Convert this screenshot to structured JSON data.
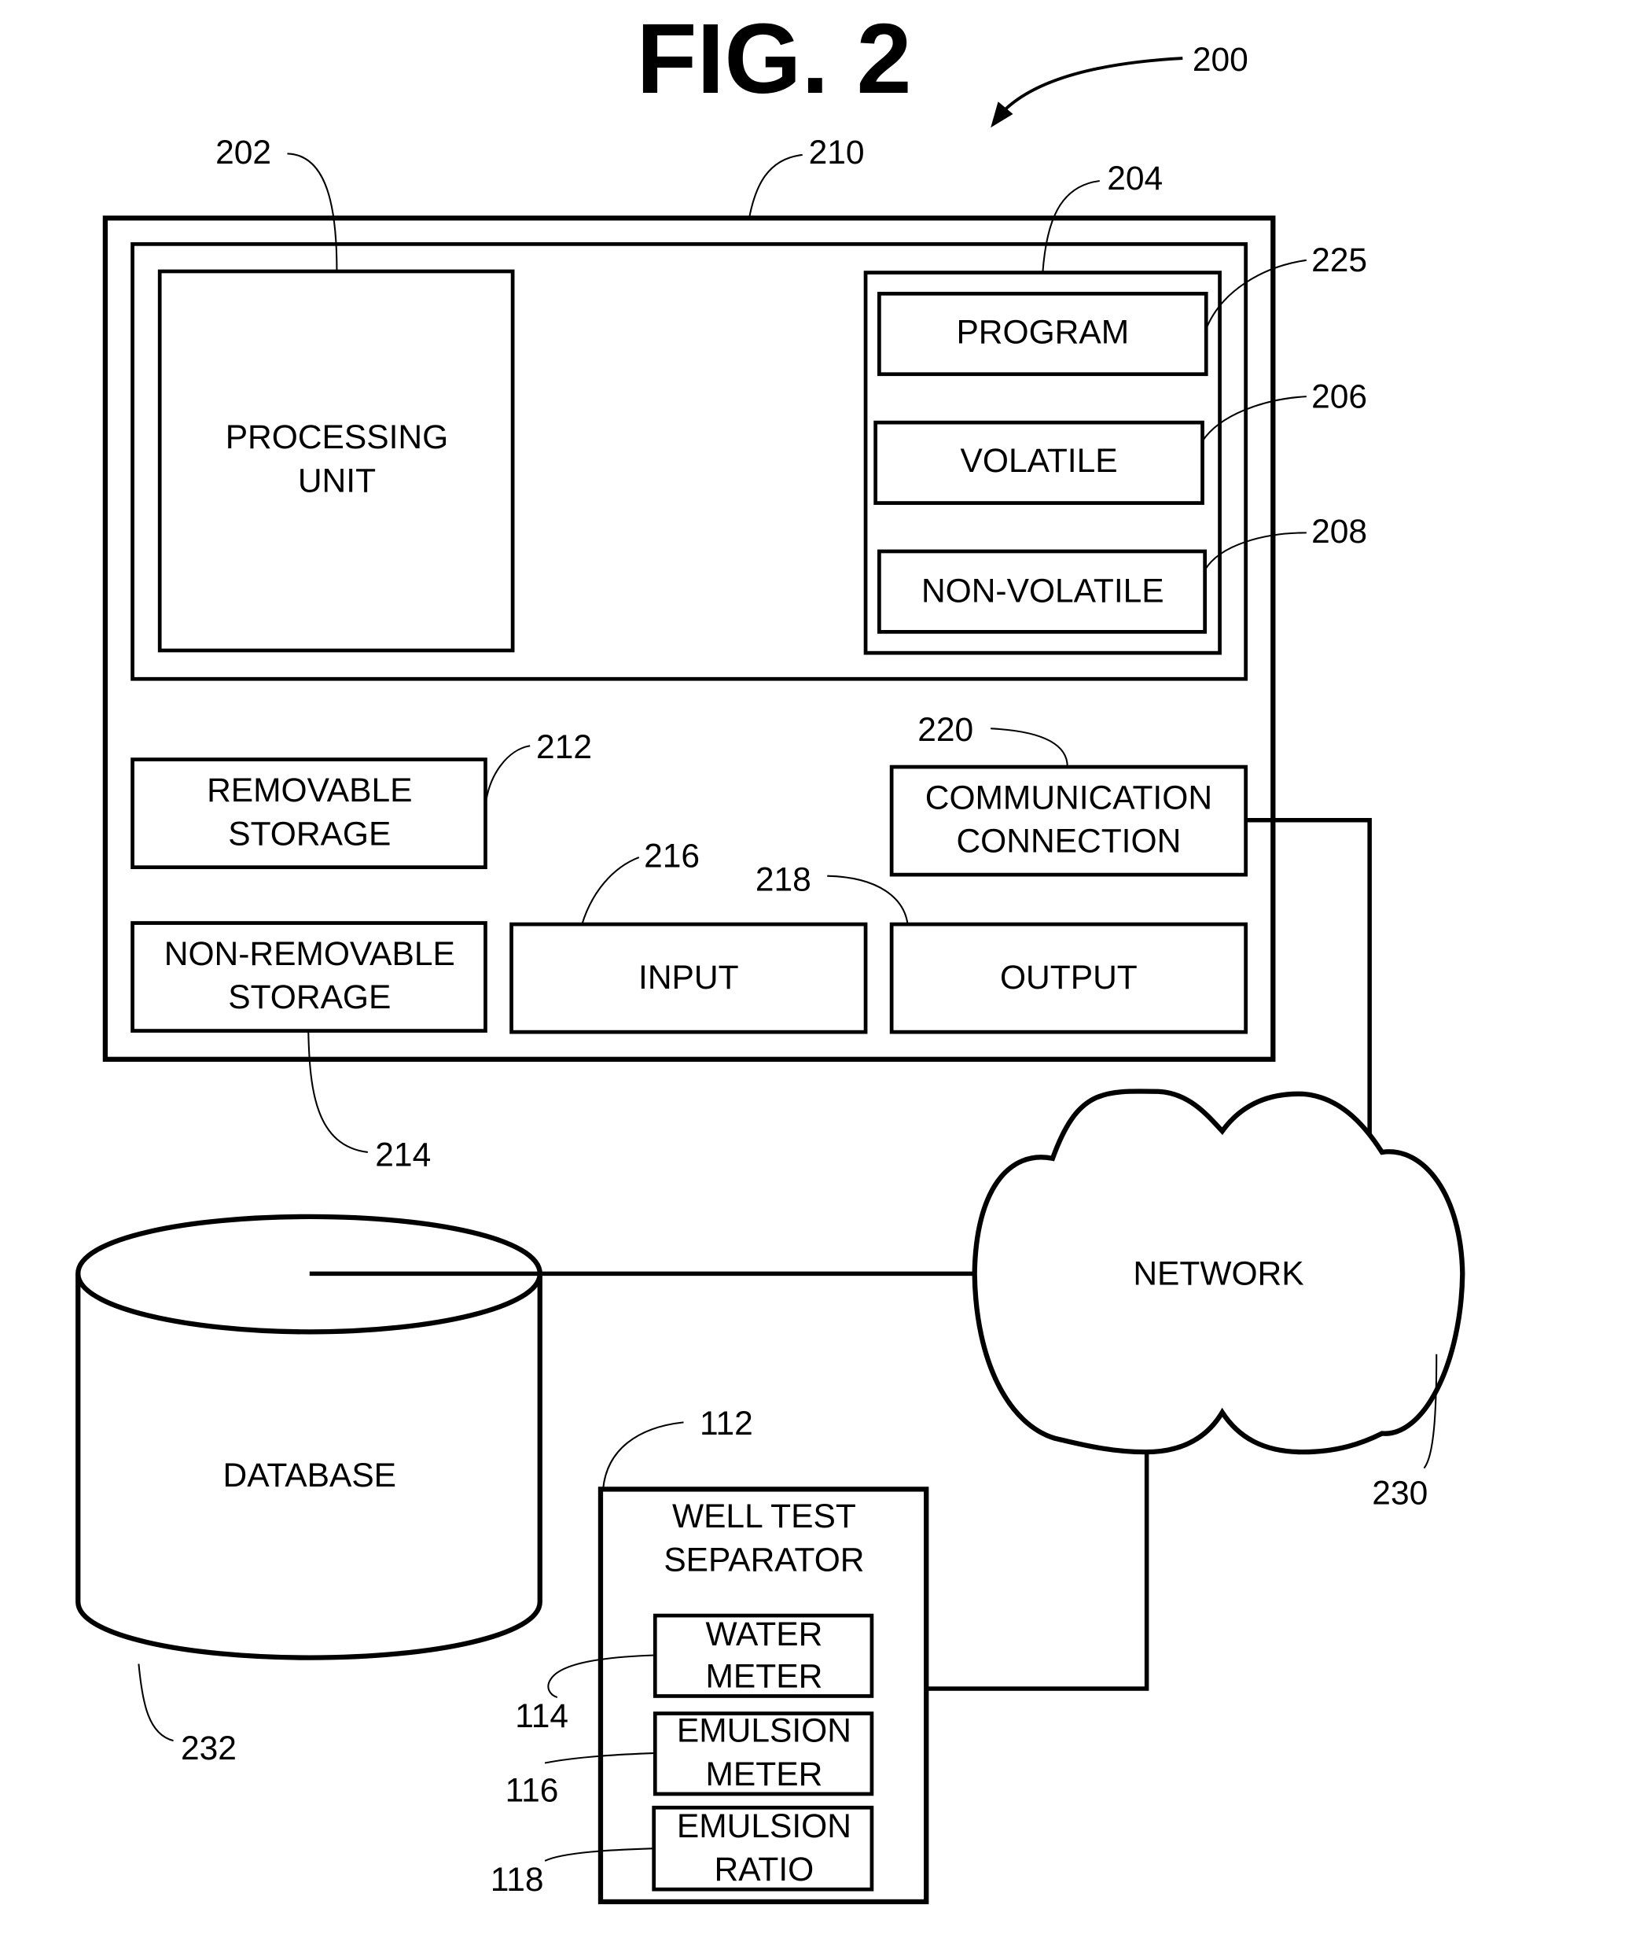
{
  "figure": {
    "title": "FIG. 2",
    "ref": "200"
  },
  "computer": {
    "ref": "210",
    "core": {
      "processing_unit": {
        "lines": [
          "PROCESSING",
          "UNIT"
        ],
        "ref": "202"
      },
      "memory": {
        "ref": "204",
        "program": {
          "label": "PROGRAM",
          "ref": "225"
        },
        "volatile": {
          "label": "VOLATILE",
          "ref": "206"
        },
        "non_volatile": {
          "label": "NON-VOLATILE",
          "ref": "208"
        }
      }
    },
    "removable_storage": {
      "lines": [
        "REMOVABLE",
        "STORAGE"
      ],
      "ref": "212"
    },
    "non_removable_storage": {
      "lines": [
        "NON-REMOVABLE",
        "STORAGE"
      ],
      "ref": "214"
    },
    "input": {
      "label": "INPUT",
      "ref": "216"
    },
    "output": {
      "label": "OUTPUT",
      "ref": "218"
    },
    "communication_connection": {
      "lines": [
        "COMMUNICATION",
        "CONNECTION"
      ],
      "ref": "220"
    }
  },
  "network": {
    "label": "NETWORK",
    "ref": "230"
  },
  "database": {
    "label": "DATABASE",
    "ref": "232"
  },
  "well_test_separator": {
    "lines": [
      "WELL TEST",
      "SEPARATOR"
    ],
    "ref": "112",
    "water_meter": {
      "lines": [
        "WATER",
        "METER"
      ],
      "ref": "114"
    },
    "emulsion_meter": {
      "lines": [
        "EMULSION",
        "METER"
      ],
      "ref": "116"
    },
    "emulsion_ratio": {
      "lines": [
        "EMULSION",
        "RATIO"
      ],
      "ref": "118"
    }
  }
}
